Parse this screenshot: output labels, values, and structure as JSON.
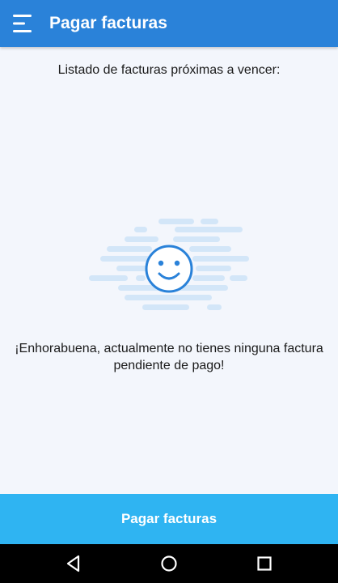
{
  "app_bar": {
    "title": "Pagar facturas",
    "menu_icon": "menu-icon",
    "color": "#2a82d9"
  },
  "content": {
    "list_heading": "Listado de facturas próximas a vencer:",
    "illustration_icon": "smiley-face-icon",
    "empty_message": "¡Enhorabuena, actualmente no tienes ninguna factura pendiente de pago!"
  },
  "action": {
    "pay_label": "Pagar facturas",
    "color": "#2fb4f2"
  },
  "nav_bar": {
    "back_icon": "back-icon",
    "home_icon": "home-icon",
    "recents_icon": "recents-icon"
  }
}
